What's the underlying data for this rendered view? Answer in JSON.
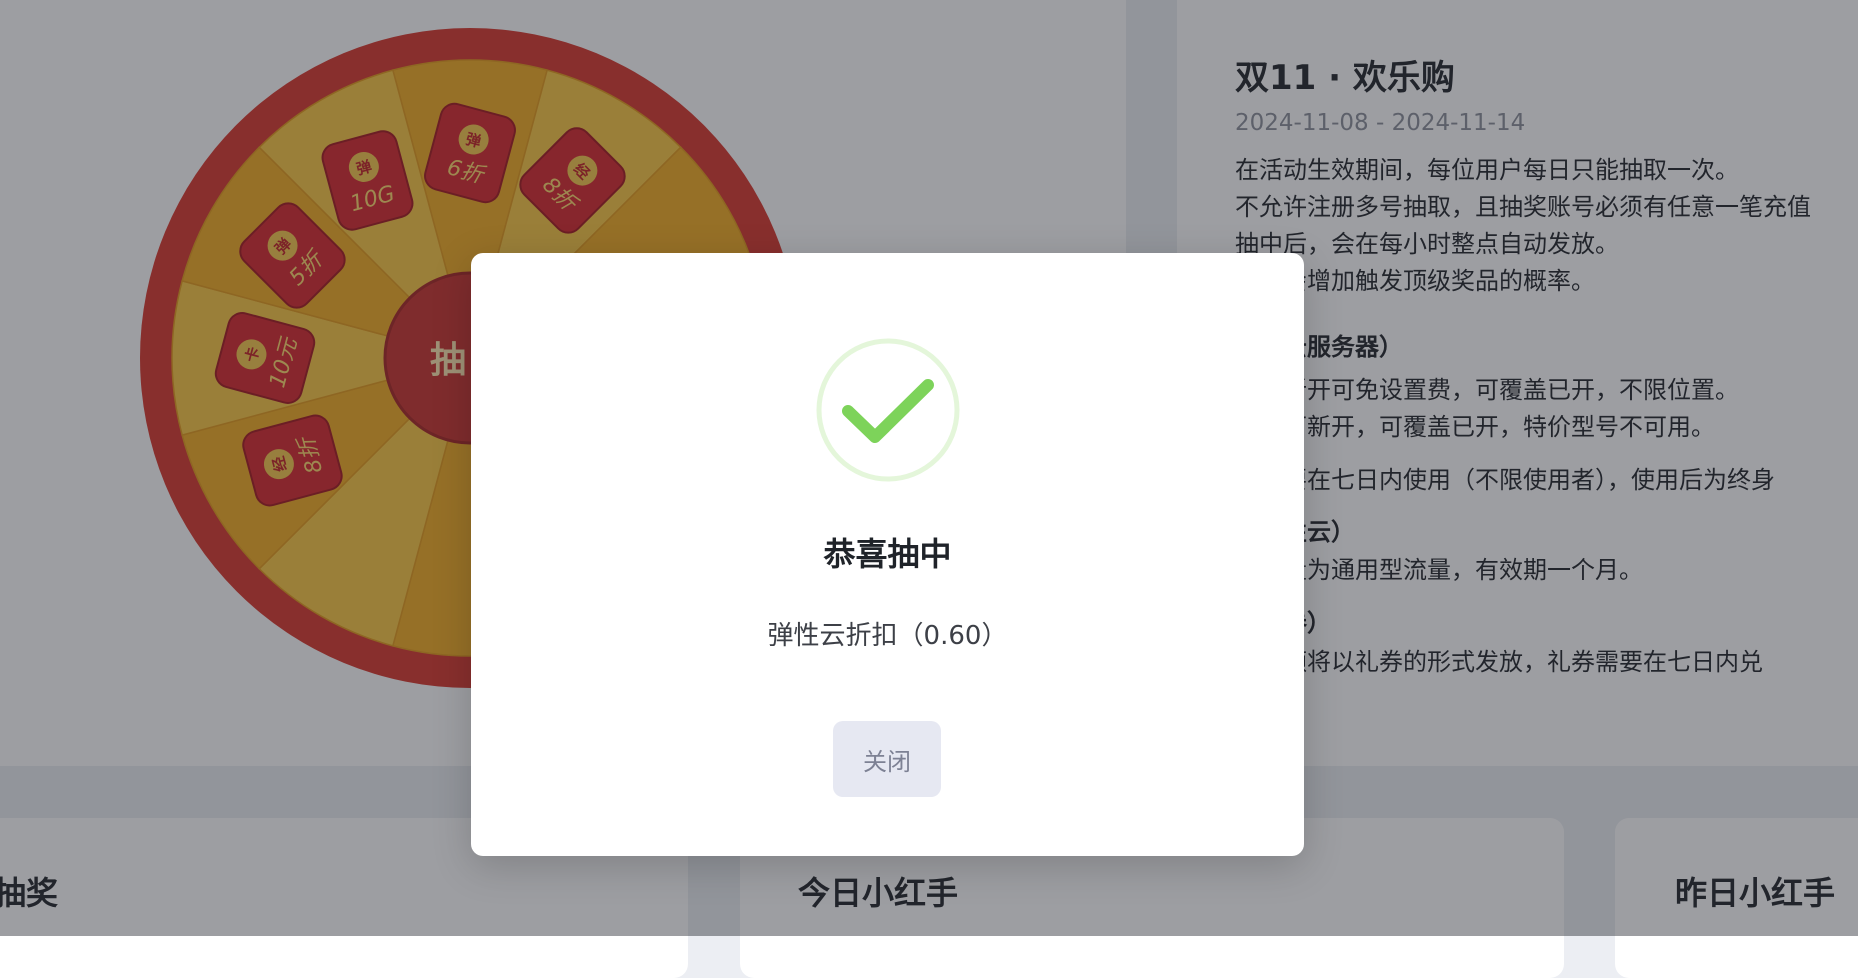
{
  "wheel": {
    "center_label": "抽",
    "prizes": [
      {
        "seal": "弹",
        "text": "6折"
      },
      {
        "seal": "经",
        "text": "8折"
      },
      {
        "seal": "",
        "text": ""
      },
      {
        "seal": "",
        "text": ""
      },
      {
        "seal": "",
        "text": ""
      },
      {
        "seal": "",
        "text": ""
      },
      {
        "seal": "",
        "text": ""
      },
      {
        "seal": "",
        "text": ""
      },
      {
        "seal": "经",
        "text": "8折"
      },
      {
        "seal": "卡",
        "text": "10元"
      },
      {
        "seal": "弹",
        "text": "5折"
      },
      {
        "seal": "弹",
        "text": "10G"
      }
    ]
  },
  "info": {
    "title": "双11 · 欢乐购",
    "date_range": "2024-11-08 - 2024-11-14",
    "rules": [
      "在活动生效期间，每位用户每日只能抽取一次。",
      "不允许注册多号抽取，且抽奖账号必须有任意一笔充值",
      "抽中后，会在每小时整点自动发放。",
      "等级会增加触发顶级奖品的概率。"
    ],
    "sec1_head": "码（云服务器）",
    "sec1_lines": [
      "云：新开可免设置费，可覆盖已开，不限位置。",
      "云：可新开，可覆盖已开，特价型号不可用。"
    ],
    "sec1_note": "码需要在七日内使用（不限使用者），使用后为终身",
    "sec2_head": "（弹性云）",
    "sec2_line": "的流量为通用型流量，有效期一个月。",
    "sec3_head": "（礼券）",
    "sec3_line": "的余额将以礼券的形式发放，礼券需要在七日内兑"
  },
  "bottom": {
    "left_title": "抽奖",
    "today_title": "今日小红手",
    "yesterday_title": "昨日小红手"
  },
  "dialog": {
    "title": "恭喜抽中",
    "result": "弹性云折扣（0.60）",
    "close_label": "关闭"
  },
  "colors": {
    "wheel_rim": "#d9362b",
    "segment_light": "#f9c640",
    "segment_dark": "#f2ab1f",
    "packet_red": "#d7262a",
    "packet_gold": "#f6c64a",
    "success_green": "#7dd35a",
    "overlay": "rgba(38,40,48,0.45)"
  }
}
